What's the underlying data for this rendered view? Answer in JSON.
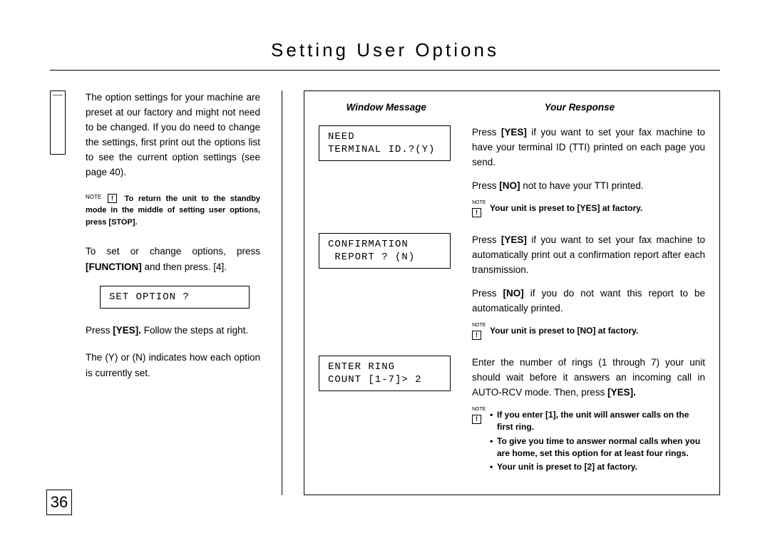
{
  "title": "Setting User Options",
  "intro": "The option  settings for your machine are preset at our factory and might not need to be changed. If you do need to change the settings, first print out the options list to see the current option settings (see page 40).",
  "note1_prefix": "NOTE",
  "note1": "To return the unit to the standby mode in the middle of setting user options, press [STOP].",
  "instr1_a": "To set or change options, press ",
  "instr1_b": "[FUNCTION]",
  "instr1_c": " and then press. [4].",
  "lcd_set_option": "SET OPTION ?",
  "instr2_a": "Press ",
  "instr2_b": "[YES].",
  "instr2_c": " Follow the steps at right.",
  "instr3": "The (Y) or (N) indicates how each option is currently set.",
  "headers": {
    "left": "Window Message",
    "right": "Your Response"
  },
  "rows": [
    {
      "lcd": "NEED\nTERMINAL ID.?(Y)",
      "resp1": "Press [YES] if you want to set your fax machine to have your terminal ID (TTI) printed on each page you send.",
      "resp2": "Press [NO] not to have your TTI printed.",
      "note_label": "NOTE",
      "note_text": "Your unit is preset to [YES] at factory."
    },
    {
      "lcd": "CONFIRMATION\n REPORT ? (N)",
      "resp1": "Press [YES] if you want to set your fax machine to automatically print out a confirmation report after each transmission.",
      "resp2": "Press [NO] if you do not want this report to be automatically printed.",
      "note_label": "NOTE",
      "note_text": "Your unit is preset to [NO] at factory."
    },
    {
      "lcd": "ENTER RING\nCOUNT [1-7]> 2",
      "resp1": "Enter the number of rings (1 through 7) your unit should wait before it answers an incoming call in AUTO-RCV mode. Then, press [YES].",
      "note_label": "NOTE",
      "bullets": [
        "If you enter [1], the unit will answer calls on the first ring.",
        "To give you time to answer normal calls when you are home, set this option for at least four rings.",
        "Your unit is preset to [2] at factory."
      ]
    }
  ],
  "page_number": "36"
}
